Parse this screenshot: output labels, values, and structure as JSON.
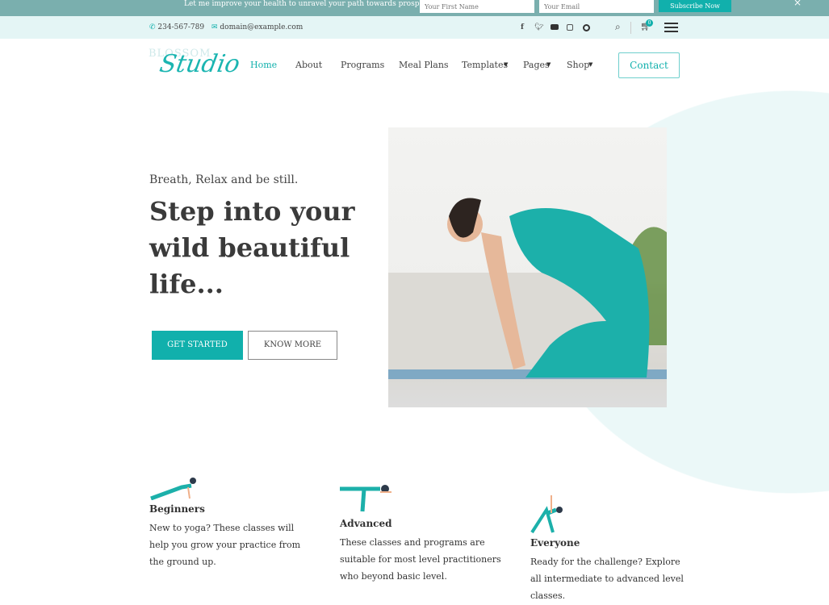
{
  "topbar": {
    "message": "Let me improve your health to unravel your path towards prosperity.",
    "first_name_placeholder": "Your First Name",
    "email_placeholder": "Your Email",
    "subscribe": "Subscribe Now",
    "close": "×"
  },
  "info": {
    "phone": "234-567-789",
    "email": "domain@example.com",
    "cart_count": "0",
    "social": [
      "facebook",
      "twitter",
      "youtube",
      "instagram",
      "pinterest"
    ]
  },
  "logo": {
    "top": "BLOSSOM",
    "script": "Studio"
  },
  "nav": {
    "items": [
      "Home",
      "About",
      "Programs",
      "Meal Plans",
      "Templates",
      "Pages",
      "Shop"
    ],
    "active": "Home",
    "contact": "Contact"
  },
  "hero": {
    "subtitle": "Breath, Relax and be still.",
    "title": "Step into your wild beautiful life...",
    "get_started": "GET STARTED",
    "know_more": "KNOW MORE"
  },
  "features": [
    {
      "title": "Beginners",
      "text": "New to yoga? These classes will help you grow your practice from the ground up."
    },
    {
      "title": "Advanced",
      "text": "These classes and programs are suitable for most level practitioners who beyond basic level."
    },
    {
      "title": "Everyone",
      "text": "Ready for the challenge? Explore all intermediate to advanced level classes."
    }
  ],
  "colors": {
    "accent": "#11b0ac",
    "topbar": "#7aafae",
    "infobar": "#e4f5f5"
  }
}
